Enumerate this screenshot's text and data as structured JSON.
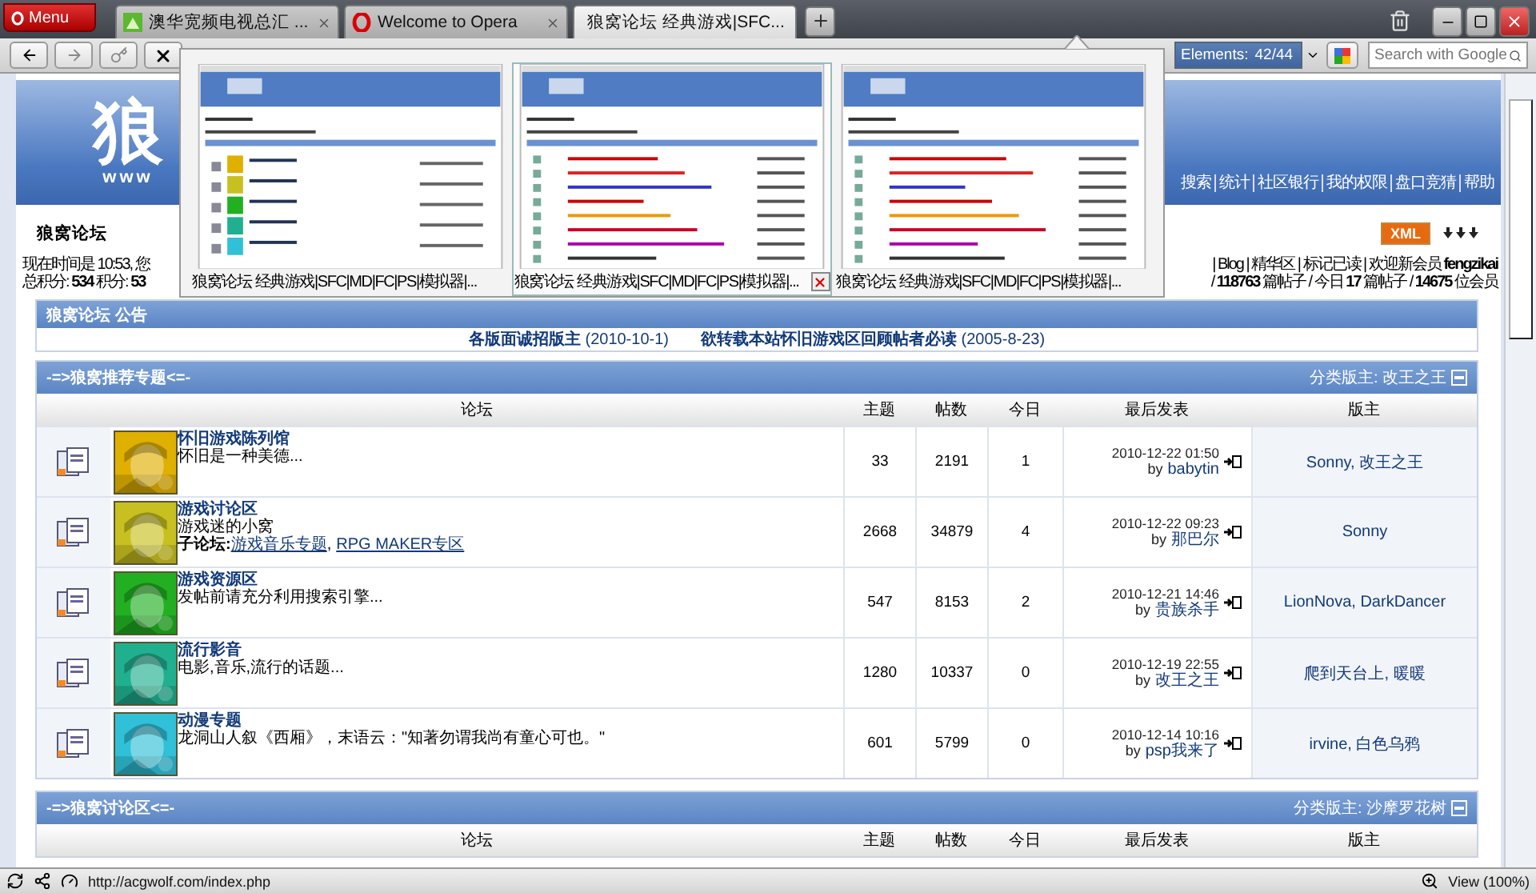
{
  "browser": {
    "menu": "Menu",
    "tabs": [
      {
        "title": "澳华宽频电视总汇  ...",
        "selected": false
      },
      {
        "title": "Welcome to Opera",
        "selected": false
      },
      {
        "title": "狼窝论坛 经典游戏|SFC...",
        "selected": true
      }
    ],
    "elements_label": "Elements:",
    "elements_count": "42/44",
    "search_placeholder": "Search with Google"
  },
  "tab_preview": {
    "thumbnails": [
      {
        "caption": "狼窝论坛 经典游戏|SFC|MD|FC|PS|模拟器|...",
        "hovered": false
      },
      {
        "caption": "狼窝论坛 经典游戏|SFC|MD|FC|PS|模拟器|...",
        "hovered": true
      },
      {
        "caption": "狼窝论坛 经典游戏|SFC|MD|FC|PS|模拟器|...",
        "hovered": false
      }
    ]
  },
  "page": {
    "logo": "狼",
    "logo_sub": "www",
    "nav": [
      "搜索",
      "统计",
      "社区银行",
      "我的权限",
      "盘口竞猜",
      "帮助"
    ],
    "title": "狼窝论坛",
    "xml": "XML",
    "info_left": [
      "现在时间是 10:53, 您",
      "总积分: **534**  积分: **53**"
    ],
    "info_right": [
      "| Blog | 精华区 | 标记已读 | 欢迎新会员 **fengzikai**",
      "/ **118763** 篇帖子 / 今日 **17** 篇帖子 / **14675** 位会员"
    ],
    "announcement": {
      "title": "狼窝论坛 公告",
      "items": [
        {
          "text": "各版面诚招版主",
          "date": "(2010-10-1)"
        },
        {
          "text": "欲转载本站怀旧游戏区回顾帖者必读",
          "date": "(2005-8-23)"
        }
      ]
    },
    "categories": [
      {
        "title": "-=>狼窝推荐专题<=-",
        "moderator_label": "分类版主:",
        "moderator": "改王之王",
        "columns": [
          "论坛",
          "主题",
          "帖数",
          "今日",
          "最后发表",
          "版主"
        ],
        "forums": [
          {
            "name": "怀旧游戏陈列馆",
            "desc": "怀旧是一种美德...",
            "topics": "33",
            "posts": "2191",
            "today": "1",
            "last_date": "2010-12-22 01:50",
            "by": "by",
            "last_by": "babytin",
            "moderators": "Sonny, 改王之王"
          },
          {
            "name": "游戏讨论区",
            "desc": "游戏迷的小窝",
            "sub_label": "子论坛:",
            "subforums": [
              "游戏音乐专题",
              "RPG MAKER专区"
            ],
            "sub_separator": ",",
            "topics": "2668",
            "posts": "34879",
            "today": "4",
            "last_date": "2010-12-22 09:23",
            "by": "by",
            "last_by": "那巴尔",
            "moderators": "Sonny"
          },
          {
            "name": "游戏资源区",
            "desc": "发帖前请充分利用搜索引擎...",
            "topics": "547",
            "posts": "8153",
            "today": "2",
            "last_date": "2010-12-21 14:46",
            "by": "by",
            "last_by": "贵族杀手",
            "moderators": "LionNova, DarkDancer"
          },
          {
            "name": "流行影音",
            "desc": "电影,音乐,流行的话题...",
            "topics": "1280",
            "posts": "10337",
            "today": "0",
            "last_date": "2010-12-19 22:55",
            "by": "by",
            "last_by": "改王之王",
            "moderators": "爬到天台上, 暖暖"
          },
          {
            "name": "动漫专题",
            "desc": "龙洞山人叙《西厢》，末语云：\"知著勿谓我尚有童心可也。\"",
            "topics": "601",
            "posts": "5799",
            "today": "0",
            "last_date": "2010-12-14 10:16",
            "by": "by",
            "last_by": "psp我来了",
            "moderators": "irvine, 白色乌鸦"
          }
        ]
      },
      {
        "title": "-=>狼窝讨论区<=-",
        "moderator_label": "分类版主:",
        "moderator": "沙摩罗花树",
        "columns": [
          "论坛",
          "主题",
          "帖数",
          "今日",
          "最后发表",
          "版主"
        ]
      }
    ]
  },
  "status_bar": {
    "url": "http://acgwolf.com/index.php",
    "zoom": "View (100%)"
  }
}
